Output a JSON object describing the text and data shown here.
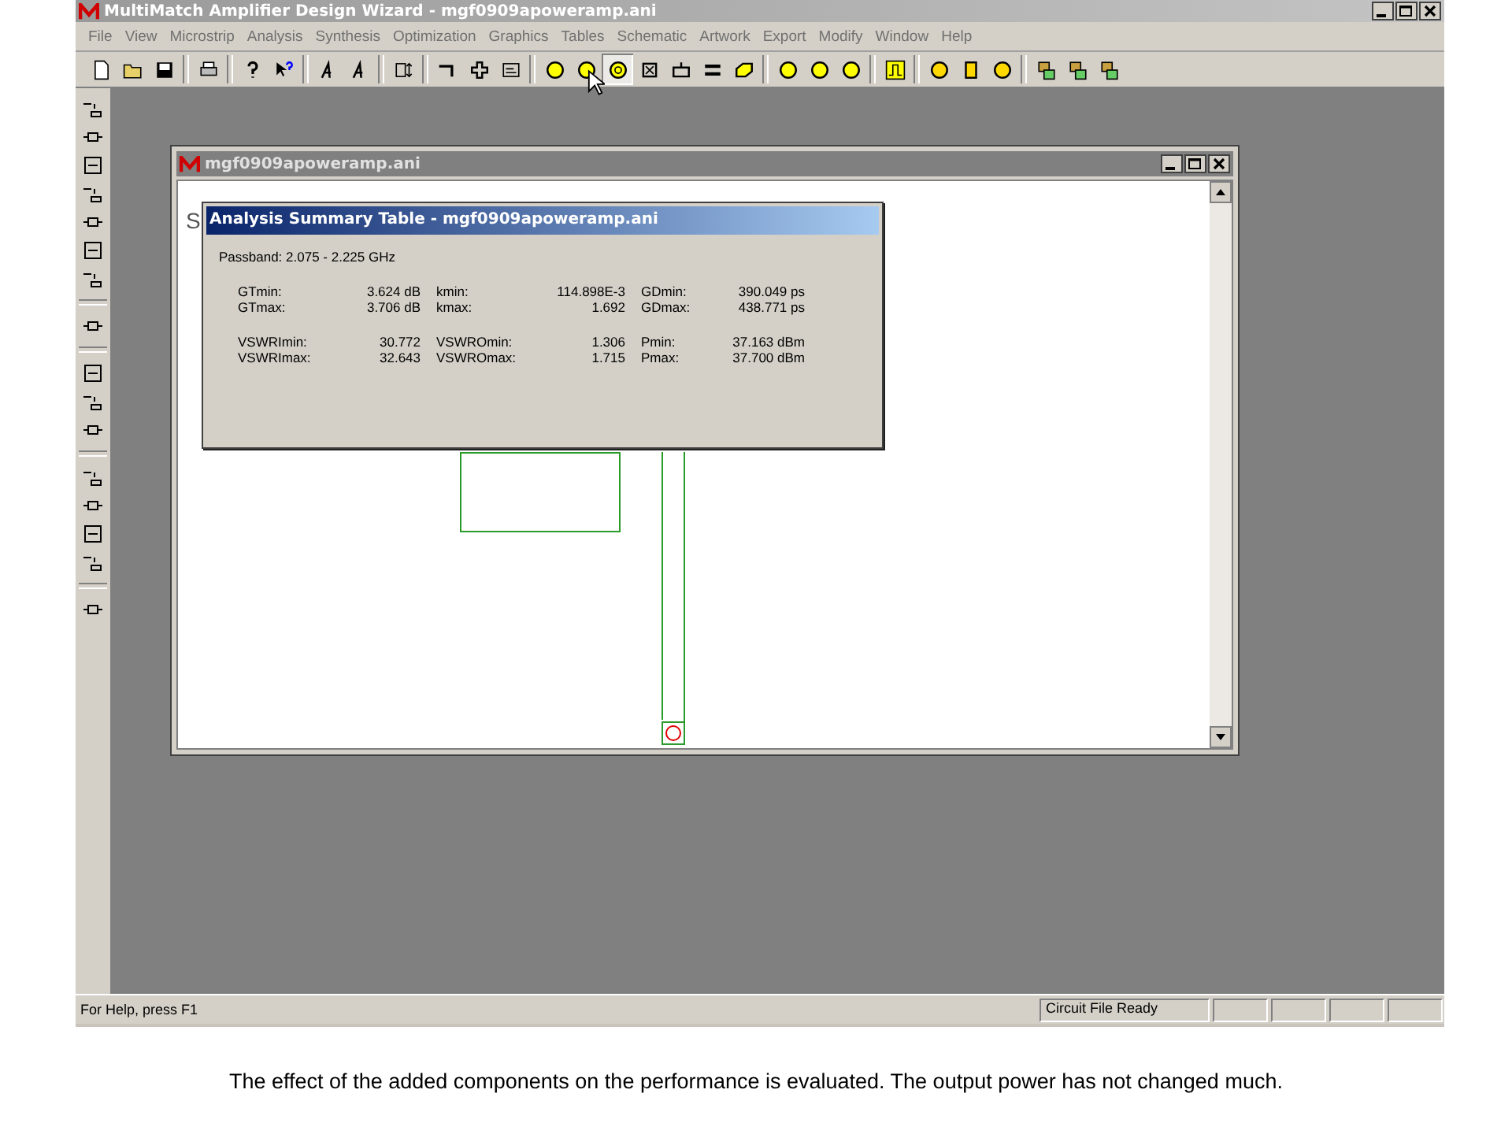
{
  "app": {
    "title": "MultiMatch Amplifier Design Wizard - mgf0909apoweramp.ani"
  },
  "menu": [
    "File",
    "View",
    "Microstrip",
    "Analysis",
    "Synthesis",
    "Optimization",
    "Graphics",
    "Tables",
    "Schematic",
    "Artwork",
    "Export",
    "Modify",
    "Window",
    "Help"
  ],
  "document_window": {
    "title": "mgf0909apoweramp.ani",
    "text": "S"
  },
  "dialog": {
    "title": "Analysis Summary Table - mgf0909apoweramp.ani",
    "passband": "Passband: 2.075 - 2.225 GHz",
    "groups": [
      {
        "rows": [
          [
            "GTmin:",
            "3.624 dB",
            "kmin:",
            "114.898E-3",
            "GDmin:",
            "390.049 ps"
          ],
          [
            "GTmax:",
            "3.706 dB",
            "kmax:",
            "1.692",
            "GDmax:",
            "438.771 ps"
          ]
        ]
      },
      {
        "rows": [
          [
            "VSWRImin:",
            "30.772",
            "VSWROmin:",
            "1.306",
            "Pmin:",
            "37.163 dBm"
          ],
          [
            "VSWRImax:",
            "32.643",
            "VSWROmax:",
            "1.715",
            "Pmax:",
            "37.700 dBm"
          ]
        ]
      }
    ]
  },
  "status_bar": {
    "help": "For Help, press F1",
    "state": "Circuit File Ready"
  },
  "caption": "The effect of the added components on the performance is evaluated. The output power has not changed much."
}
